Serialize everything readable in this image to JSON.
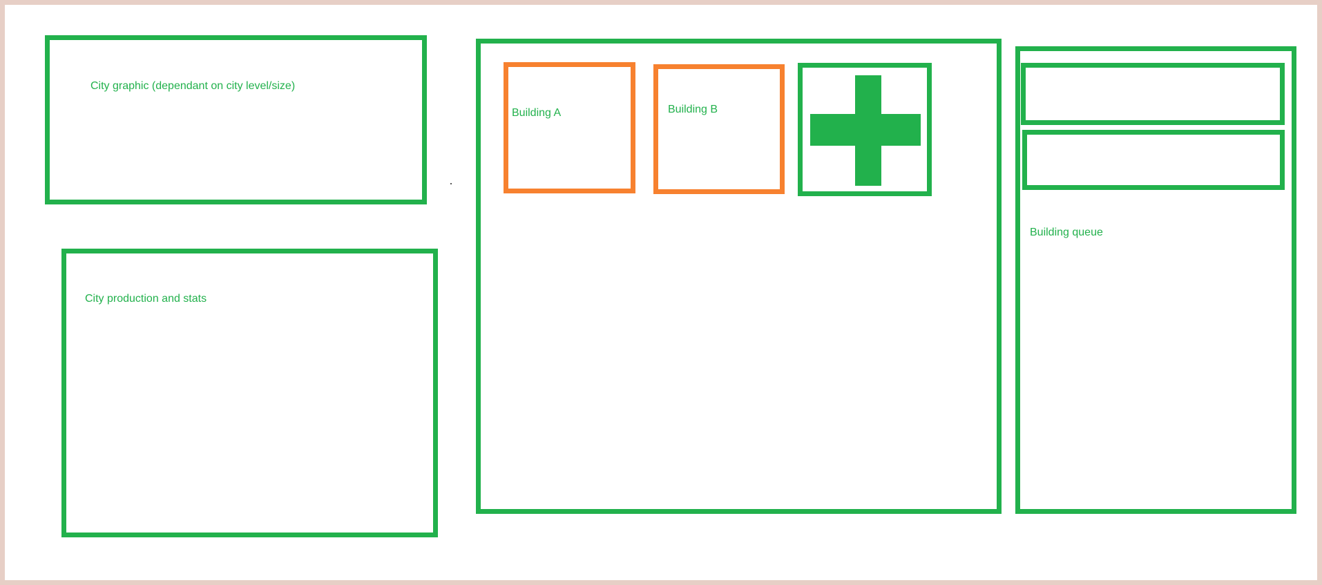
{
  "colors": {
    "frame": "#e7cfc6",
    "panel": "#22b14c",
    "building": "#f7812f",
    "text": "#22b14c"
  },
  "city_graphic": {
    "label": "City graphic (dependant on city level/size)"
  },
  "city_stats": {
    "label": "City production and stats"
  },
  "buildings": {
    "items": [
      {
        "label": "Building A"
      },
      {
        "label": "Building B"
      }
    ],
    "add_icon": "plus-icon"
  },
  "queue": {
    "label": "Building queue",
    "slots": 2
  }
}
